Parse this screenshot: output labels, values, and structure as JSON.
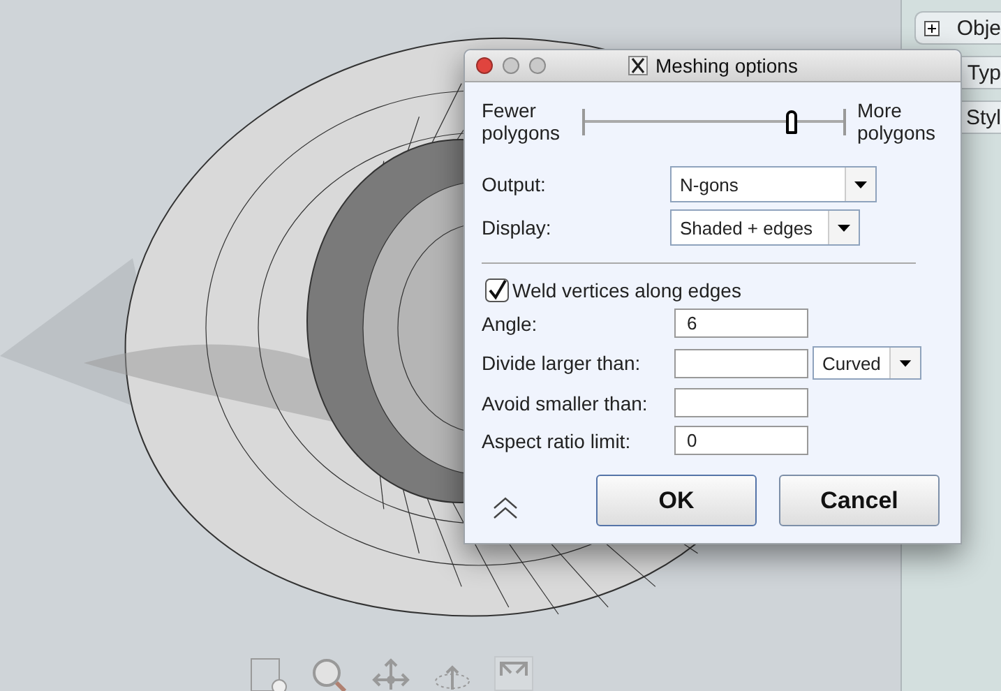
{
  "side_panel": {
    "items": [
      {
        "label": "Obje",
        "expanded": false
      },
      {
        "label": "Typ"
      },
      {
        "label": "Styl"
      }
    ]
  },
  "dialog": {
    "title": "Meshing options",
    "slider": {
      "min_label": "Fewer polygons",
      "max_label": "More polygons",
      "level": 0.8
    },
    "selects": [
      {
        "label": "Output:",
        "value": "N-gons",
        "wide": true
      },
      {
        "label": "Display:",
        "value": "Shaded + edges",
        "wide": false
      }
    ],
    "weld": {
      "label": "Weld vertices along edges",
      "checked": true
    },
    "fields": [
      {
        "label": "Angle:",
        "value": "6"
      },
      {
        "label": "Divide larger than:",
        "unit": "Curved"
      },
      {
        "label": "Avoid smaller than:"
      },
      {
        "label": "Aspect ratio limit:",
        "value": "0"
      }
    ],
    "buttons": [
      {
        "label": "OK",
        "default": true
      },
      {
        "label": "Cancel",
        "default": false
      }
    ]
  }
}
